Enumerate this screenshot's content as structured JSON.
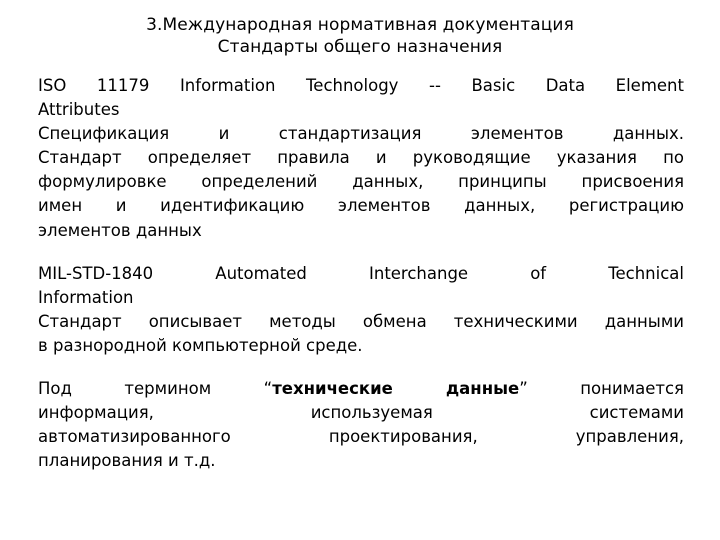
{
  "slide": {
    "background_color": "#ffffff",
    "text_color": "#000000",
    "title": {
      "line1": "3.Международная нормативная документация",
      "line2": "Стандарты общего назначения"
    },
    "paragraphs": [
      {
        "id": "iso-11179",
        "lines": [
          "ISO 11179 Information Technology -- Basic Data Element",
          "Attributes",
          "Спецификация и стандартизация элементов данных.",
          "Стандарт определяет правила и руководящие указания по",
          "формулировке определений данных, принципы присвоения",
          "имен и идентификацию элементов данных, регистрацию",
          "элементов данных"
        ]
      },
      {
        "id": "mil-std-1840",
        "lines": [
          "MIL-STD-1840 Automated Interchange of Technical",
          "Information",
          "Стандарт описывает методы обмена техническими данными",
          "в разнородной компьютерной среде."
        ]
      },
      {
        "id": "technical-data-definition",
        "lines": [
          "Под термином “технические данные” понимается",
          "информация, используемая системами",
          "автоматизированного проектирования, управления,",
          "планирования и т.д."
        ],
        "line1_segments": {
          "before": "Под термином ",
          "quote_open": "“",
          "emphasis": "технические данные",
          "quote_close": "”",
          "after": " понимается"
        }
      }
    ]
  }
}
